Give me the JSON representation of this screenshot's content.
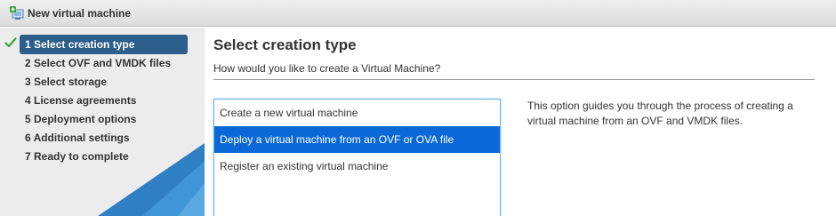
{
  "window": {
    "title": "New virtual machine"
  },
  "sidebar": {
    "steps": [
      {
        "label": "1 Select creation type",
        "completed": true,
        "active": true
      },
      {
        "label": "2 Select OVF and VMDK files",
        "completed": false,
        "active": false
      },
      {
        "label": "3 Select storage",
        "completed": false,
        "active": false
      },
      {
        "label": "4 License agreements",
        "completed": false,
        "active": false
      },
      {
        "label": "5 Deployment options",
        "completed": false,
        "active": false
      },
      {
        "label": "6 Additional settings",
        "completed": false,
        "active": false
      },
      {
        "label": "7 Ready to complete",
        "completed": false,
        "active": false
      }
    ]
  },
  "main": {
    "title": "Select creation type",
    "subtitle": "How would you like to create a Virtual Machine?",
    "options": [
      {
        "label": "Create a new virtual machine",
        "selected": false
      },
      {
        "label": "Deploy a virtual machine from an OVF or OVA file",
        "selected": true
      },
      {
        "label": "Register an existing virtual machine",
        "selected": false
      }
    ],
    "description": "This option guides you through the process of creating a virtual machine from an OVF and VMDK files."
  },
  "colors": {
    "active_step_bg": "#2c5e8c",
    "selected_option_bg": "#0a69d6",
    "check_green": "#3aa33a",
    "sidebar_bg": "#ececec"
  }
}
